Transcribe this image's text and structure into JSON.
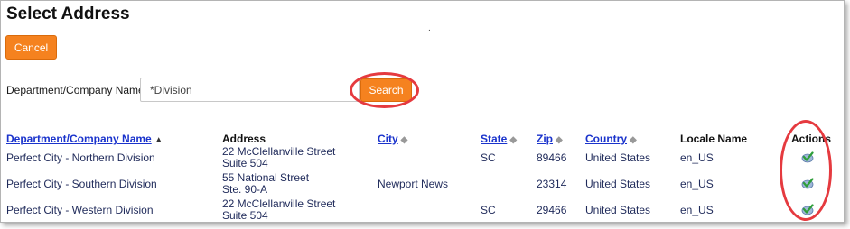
{
  "page": {
    "title": "Select Address",
    "dot": "."
  },
  "buttons": {
    "cancel": "Cancel",
    "search": "Search"
  },
  "search": {
    "label": "Department/Company Name",
    "value": "*Division"
  },
  "table": {
    "headers": {
      "name": "Department/Company Name",
      "address": "Address",
      "city": "City",
      "state": "State",
      "zip": "Zip",
      "country": "Country",
      "locale": "Locale Name",
      "actions": "Actions"
    },
    "sort": {
      "asc": "▲",
      "sortable": "◆"
    },
    "rows": [
      {
        "name": "Perfect City - Northern Division",
        "address1": "22 McClellanville Street",
        "address2": "Suite 504",
        "city": "",
        "state": "SC",
        "zip": "89466",
        "country": "United States",
        "locale": "en_US"
      },
      {
        "name": "Perfect City - Southern Division",
        "address1": "55 National Street",
        "address2": "Ste. 90-A",
        "city": "Newport News",
        "state": "",
        "zip": "23314",
        "country": "United States",
        "locale": "en_US"
      },
      {
        "name": "Perfect City - Western Division",
        "address1": "22 McClellanville Street",
        "address2": "Suite 504",
        "city": "",
        "state": "SC",
        "zip": "29466",
        "country": "United States",
        "locale": "en_US"
      }
    ],
    "action_icon": "select-check-icon"
  },
  "colors": {
    "accent": "#f5821f",
    "link": "#1a33cc",
    "highlight": "#e53a3f",
    "check": "#2e9e3a"
  }
}
